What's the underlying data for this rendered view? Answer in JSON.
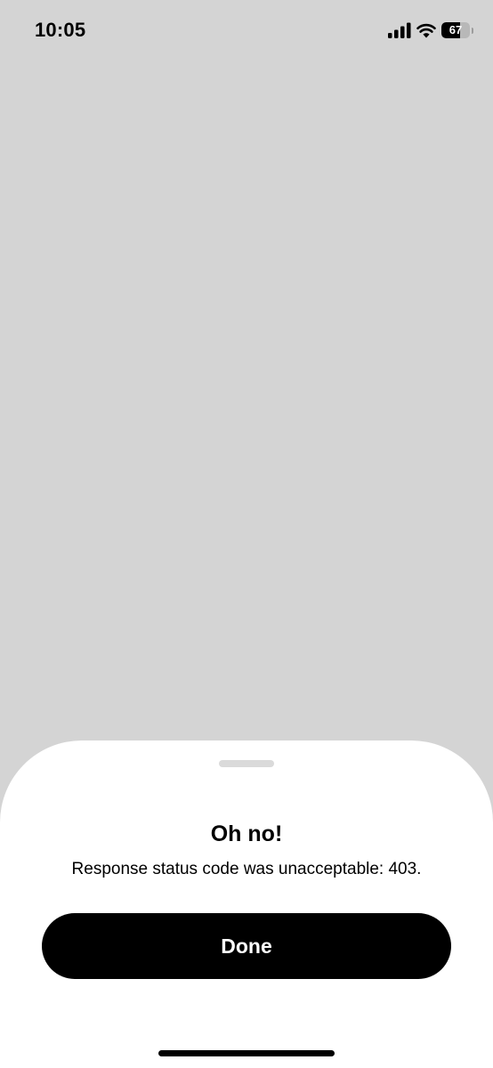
{
  "status_bar": {
    "time": "10:05",
    "battery": {
      "level": 67,
      "label": "67",
      "fill_color": "#000000"
    },
    "icons": [
      "signal-icon",
      "wifi-icon",
      "battery-icon"
    ]
  },
  "sheet": {
    "title": "Oh no!",
    "message": "Response status code was unacceptable: 403.",
    "done_label": "Done"
  },
  "colors": {
    "background": "#d4d4d4",
    "sheet": "#ffffff",
    "button": "#000000",
    "button_text": "#ffffff"
  }
}
